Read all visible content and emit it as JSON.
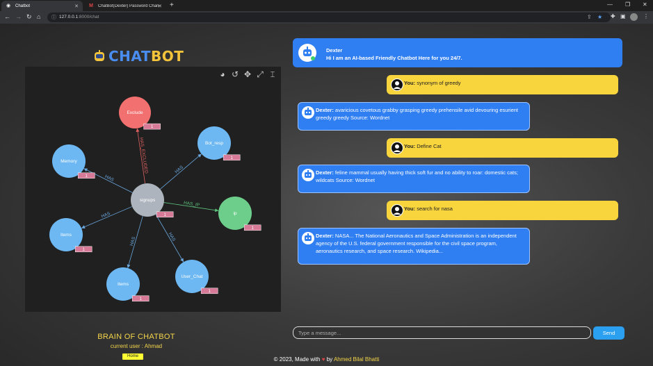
{
  "browser": {
    "tabs": [
      {
        "title": "Chatbot",
        "icon": "page-icon",
        "active": true
      },
      {
        "title": "ChatBot(Dexter) Password Chang",
        "icon": "gmail-icon",
        "active": false
      }
    ],
    "url_host": "127.0.0.1",
    "url_path": ":8000/chat"
  },
  "logo": {
    "text_chat": "CHAT",
    "text_bot": "BOT",
    "chat_color": "#4a8df0",
    "bot_color": "#f3c33b"
  },
  "graph": {
    "tools": [
      "screenshot-icon",
      "reset-icon",
      "move-icon",
      "fullscreen-icon",
      "text-icon"
    ],
    "center": {
      "id": "signups",
      "label": "signups",
      "badge": "1",
      "color": "#aeb4bd"
    },
    "nodes": [
      {
        "id": "exclude",
        "label": "Exclude",
        "badge": "1",
        "color": "#f27070",
        "edge": "HAS_EXCLUDED",
        "edge_color": "#e06060"
      },
      {
        "id": "bot_resp",
        "label": "Bot_resp",
        "badge": "1",
        "color": "#6db8f2",
        "edge": "HAS",
        "edge_color": "#6aa8e0"
      },
      {
        "id": "memory",
        "label": "Memory",
        "badge": "1",
        "color": "#6db8f2",
        "edge": "HAS",
        "edge_color": "#6aa8e0"
      },
      {
        "id": "ip",
        "label": "ip",
        "badge": "1",
        "color": "#6cce8a",
        "edge": "HAS_IP",
        "edge_color": "#5cc47c"
      },
      {
        "id": "items1",
        "label": "Items",
        "badge": "1",
        "color": "#6db8f2",
        "edge": "HAS",
        "edge_color": "#6aa8e0"
      },
      {
        "id": "items2",
        "label": "Items",
        "badge": "1",
        "color": "#6db8f2",
        "edge": "HAS",
        "edge_color": "#6aa8e0"
      },
      {
        "id": "user_chat",
        "label": "User_Chat",
        "badge": "1",
        "color": "#6db8f2",
        "edge": "HAS",
        "edge_color": "#6aa8e0"
      }
    ],
    "badge_color": "#d77a98"
  },
  "brain": {
    "title": "BRAIN OF CHATBOT",
    "user_line": "current user : Ahmad",
    "home_label": "Home"
  },
  "footer": {
    "prefix": "© 2023, Made with",
    "heart": "♥",
    "by": "by",
    "author": "Ahmed Bilal Bhatti"
  },
  "chat": {
    "hero": {
      "name": "Dexter",
      "message": "Hi I am an AI-based Friendly Chatbot Here for you 24/7."
    },
    "messages": [
      {
        "sender": "You:",
        "text": " synonym of greedy",
        "type": "you"
      },
      {
        "sender": "Dexter:",
        "text": " avaricious covetous grabby grasping greedy prehensile avid devouring esurient greedy greedy Source: Wordnet",
        "type": "bot"
      },
      {
        "sender": "You:",
        "text": " Define Cat",
        "type": "you"
      },
      {
        "sender": "Dexter:",
        "text": " feline mammal usually having thick soft fur and no ability to roar: domestic cats; wildcats Source: Wordnet",
        "type": "bot"
      },
      {
        "sender": "You:",
        "text": " search for nasa",
        "type": "you"
      },
      {
        "sender": "Dexter:",
        "text": " NASA... The National Aeronautics and Space Administration is an independent agency of the U.S. federal government responsible for the civil space program, aeronautics research, and space research. Wikipedia...",
        "type": "bot"
      }
    ],
    "input_placeholder": "Type a message...",
    "send_label": "Send"
  }
}
